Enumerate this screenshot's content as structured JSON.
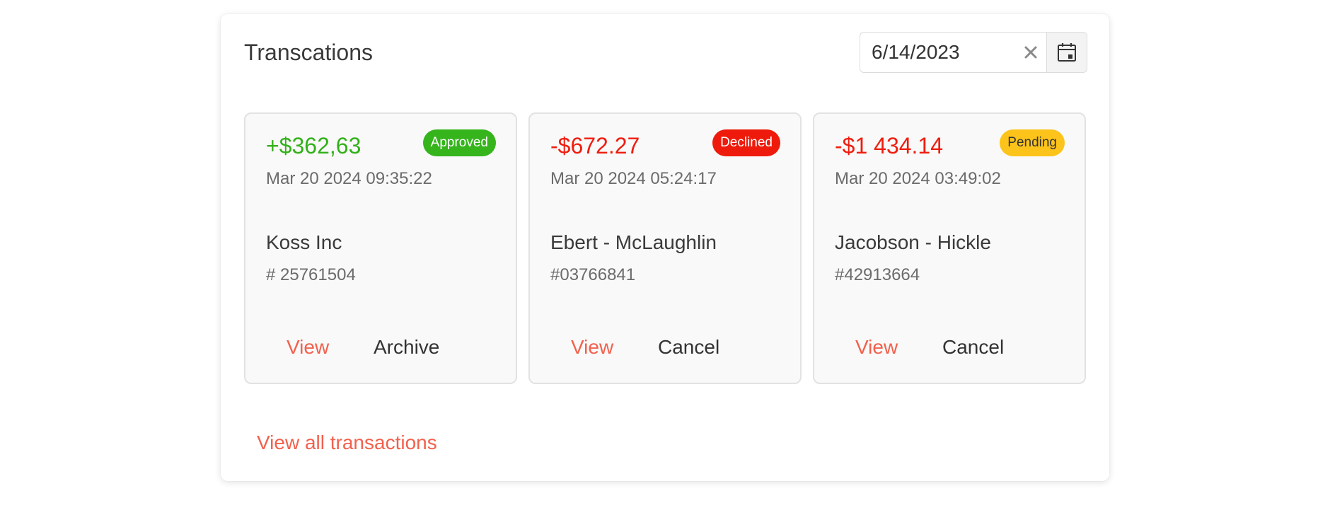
{
  "header": {
    "title": "Transcations"
  },
  "date_picker": {
    "value": "6/14/2023",
    "clear_icon": "close-icon",
    "calendar_icon": "calendar-icon"
  },
  "transactions": [
    {
      "amount": "+$362,63",
      "sign": "positive",
      "status": "Approved",
      "timestamp": "Mar 20 2024 09:35:22",
      "company": "Koss Inc",
      "id": "# 25761504",
      "view_label": "View",
      "secondary_label": "Archive"
    },
    {
      "amount": "-$672.27",
      "sign": "negative",
      "status": "Declined",
      "timestamp": "Mar 20 2024 05:24:17",
      "company": "Ebert - McLaughlin",
      "id": "#03766841",
      "view_label": "View",
      "secondary_label": "Cancel"
    },
    {
      "amount": "-$1 434.14",
      "sign": "negative",
      "status": "Pending",
      "timestamp": "Mar 20 2024 03:49:02",
      "company": "Jacobson - Hickle",
      "id": "#42913664",
      "view_label": "View",
      "secondary_label": "Cancel"
    }
  ],
  "footer": {
    "view_all_label": "View all transactions"
  },
  "colors": {
    "accent": "#f2614d",
    "positive": "#33b01b",
    "negative": "#ef1d0f",
    "approved_bg": "#35b41c",
    "declined_bg": "#ee1b0c",
    "pending_bg": "#fcc41a"
  }
}
